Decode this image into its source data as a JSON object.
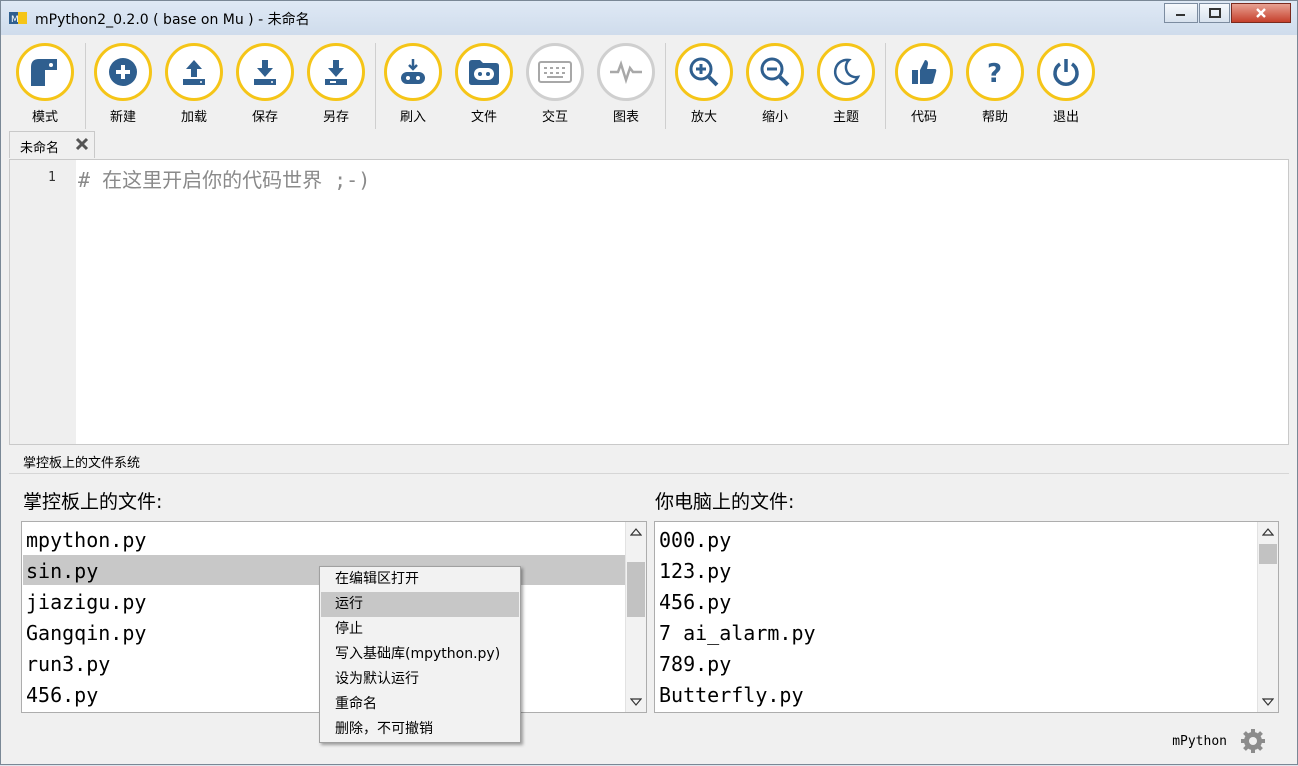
{
  "window": {
    "title": "mPython2_0.2.0 ( base on Mu ) - 未命名"
  },
  "toolbar": {
    "buttons": [
      {
        "label": "模式",
        "icon": "mode-icon"
      },
      {
        "label": "新建",
        "icon": "plus-icon"
      },
      {
        "label": "加载",
        "icon": "upload-icon"
      },
      {
        "label": "保存",
        "icon": "download-icon"
      },
      {
        "label": "另存",
        "icon": "save-as-icon"
      },
      {
        "label": "刷入",
        "icon": "flash-device-icon"
      },
      {
        "label": "文件",
        "icon": "files-icon"
      },
      {
        "label": "交互",
        "icon": "keyboard-icon"
      },
      {
        "label": "图表",
        "icon": "pulse-chart-icon"
      },
      {
        "label": "放大",
        "icon": "zoom-in-icon"
      },
      {
        "label": "缩小",
        "icon": "zoom-out-icon"
      },
      {
        "label": "主题",
        "icon": "moon-icon"
      },
      {
        "label": "代码",
        "icon": "thumbs-up-icon"
      },
      {
        "label": "帮助",
        "icon": "help-icon"
      },
      {
        "label": "退出",
        "icon": "power-icon"
      }
    ]
  },
  "tab": {
    "label": "未命名"
  },
  "editor": {
    "line_number": "1",
    "code": "# 在这里开启你的代码世界 ;-)"
  },
  "files_pane": {
    "title": "掌控板上的文件系统",
    "device_label": "掌控板上的文件:",
    "computer_label": "你电脑上的文件:",
    "device_files": [
      "mpython.py",
      "sin.py",
      "jiazigu.py",
      "Gangqin.py",
      "run3.py",
      "456.py"
    ],
    "selected_device_file": "sin.py",
    "computer_files": [
      "000.py",
      "123.py",
      "456.py",
      "7 ai_alarm.py",
      "789.py",
      "Butterfly.py"
    ]
  },
  "context_menu": {
    "items": [
      "在编辑区打开",
      "运行",
      "停止",
      "写入基础库(mpython.py)",
      "设为默认运行",
      "重命名",
      "删除，不可撤销"
    ],
    "highlighted": "运行"
  },
  "status": {
    "mode": "mPython"
  },
  "colors": {
    "accent": "#f5c518",
    "icon_blue": "#2f5f8f",
    "disabled": "#cfcfcf",
    "close_red": "#c5402c"
  }
}
